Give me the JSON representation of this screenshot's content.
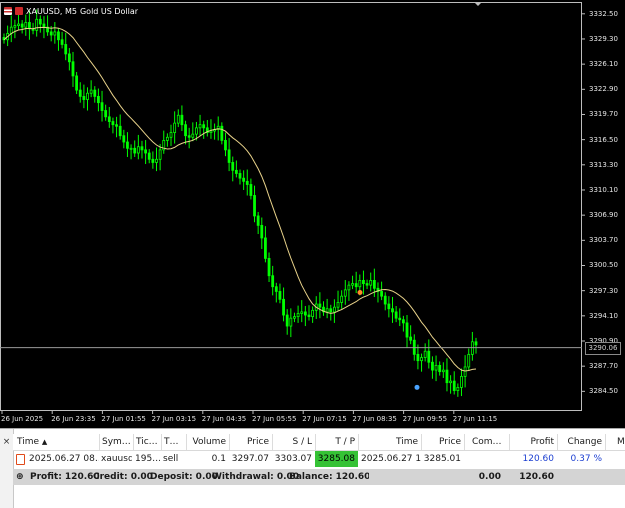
{
  "window": {
    "symbol": "XAUUSD, M5",
    "description": "Gold US Dollar"
  },
  "chart_data": {
    "type": "candlestick",
    "title": "XAUUSD, M5: Gold US Dollar",
    "y_tick_labels": [
      "3332.50",
      "3329.30",
      "3326.10",
      "3322.90",
      "3319.70",
      "3316.50",
      "3313.30",
      "3310.10",
      "3306.90",
      "3303.70",
      "3300.50",
      "3297.30",
      "3294.10",
      "3290.90",
      "3287.70",
      "3284.50"
    ],
    "y_range": [
      3282.0,
      3334.0
    ],
    "x_tick_labels": [
      "26 Jun 2025",
      "26 Jun 23:35",
      "27 Jun 01:55",
      "27 Jun 03:15",
      "27 Jun 04:35",
      "27 Jun 05:55",
      "27 Jun 07:15",
      "27 Jun 08:35",
      "27 Jun 09:55",
      "27 Jun 11:15"
    ],
    "current_price_label": "3290.06",
    "current_price": 3290.06,
    "candles_close": [
      3329.2,
      3330.0,
      3330.8,
      3331.0,
      3331.2,
      3330.8,
      3331.4,
      3330.6,
      3330.4,
      3331.8,
      3331.2,
      3330.8,
      3330.2,
      3329.8,
      3330.2,
      3329.2,
      3328.6,
      3327.4,
      3326.4,
      3324.6,
      3322.8,
      3322.0,
      3321.6,
      3322.4,
      3322.8,
      3322.0,
      3321.2,
      3320.2,
      3319.4,
      3318.8,
      3318.4,
      3318.2,
      3317.0,
      3316.2,
      3315.4,
      3315.4,
      3314.8,
      3315.6,
      3315.2,
      3314.8,
      3314.0,
      3313.6,
      3314.0,
      3315.2,
      3316.4,
      3316.8,
      3317.4,
      3318.6,
      3319.6,
      3318.4,
      3317.0,
      3316.8,
      3317.2,
      3318.0,
      3318.4,
      3318.0,
      3317.4,
      3317.6,
      3317.8,
      3318.2,
      3316.4,
      3315.2,
      3313.6,
      3312.6,
      3312.2,
      3311.6,
      3311.2,
      3310.8,
      3309.4,
      3306.8,
      3305.6,
      3304.0,
      3301.4,
      3299.2,
      3297.8,
      3297.2,
      3296.2,
      3294.2,
      3292.8,
      3293.8,
      3294.0,
      3294.4,
      3294.6,
      3294.2,
      3294.0,
      3294.8,
      3295.6,
      3295.2,
      3294.6,
      3295.0,
      3294.6,
      3295.2,
      3295.8,
      3296.6,
      3297.4,
      3298.0,
      3298.2,
      3297.8,
      3298.6,
      3298.2,
      3298.0,
      3298.6,
      3297.6,
      3297.2,
      3296.6,
      3295.6,
      3295.0,
      3294.6,
      3293.8,
      3293.6,
      3293.2,
      3291.4,
      3291.0,
      3289.2,
      3288.4,
      3288.8,
      3289.6,
      3288.2,
      3287.2,
      3287.8,
      3287.0,
      3287.2,
      3285.6,
      3285.8,
      3284.6,
      3285.0,
      3286.4,
      3287.6,
      3289.2,
      3290.8,
      3290.4
    ],
    "moving_average": "yellow line following price"
  },
  "colors": {
    "up": "#00ff00",
    "down": "#00ff00",
    "ma": "#e8d28a",
    "bg": "#000000",
    "grid_text": "#e6e6e6"
  },
  "toolbox": {
    "close_icon": "×",
    "columns": [
      "Time",
      "Symbol",
      "Ticket",
      "Type",
      "Volume",
      "Price",
      "S / L",
      "T / P",
      "Time",
      "Price",
      "Commission",
      "Profit",
      "Change"
    ],
    "header": {
      "time": "Time",
      "sort_icon": "▲",
      "symbol": "Sym…",
      "ticket": "Tic…",
      "type": "T…",
      "volume": "Volume",
      "price": "Price",
      "sl": "S / L",
      "tp": "T / P",
      "time2": "Time",
      "price2": "Price",
      "commission": "Com…",
      "profit": "Profit",
      "change": "Change",
      "extra": "M"
    },
    "row": {
      "time": "2025.06.27 08…",
      "symbol": "xauusd",
      "ticket": "195…",
      "type": "sell",
      "volume": "0.1",
      "price": "3297.07",
      "sl": "3303.07",
      "tp": "3285.08",
      "time2": "2025.06.27 1…",
      "price2": "3285.01",
      "commission": "",
      "profit": "120.60",
      "change": "0.37 %"
    },
    "totals": {
      "expand_icon": "⊕",
      "profit": "Profit: 120.60",
      "credit": "Credit: 0.00",
      "deposit": "Deposit: 0.00",
      "withdrawal": "Withdrawal: 0.00",
      "balance": "Balance: 120.60",
      "commission": "0.00",
      "profit_value": "120.60"
    }
  }
}
